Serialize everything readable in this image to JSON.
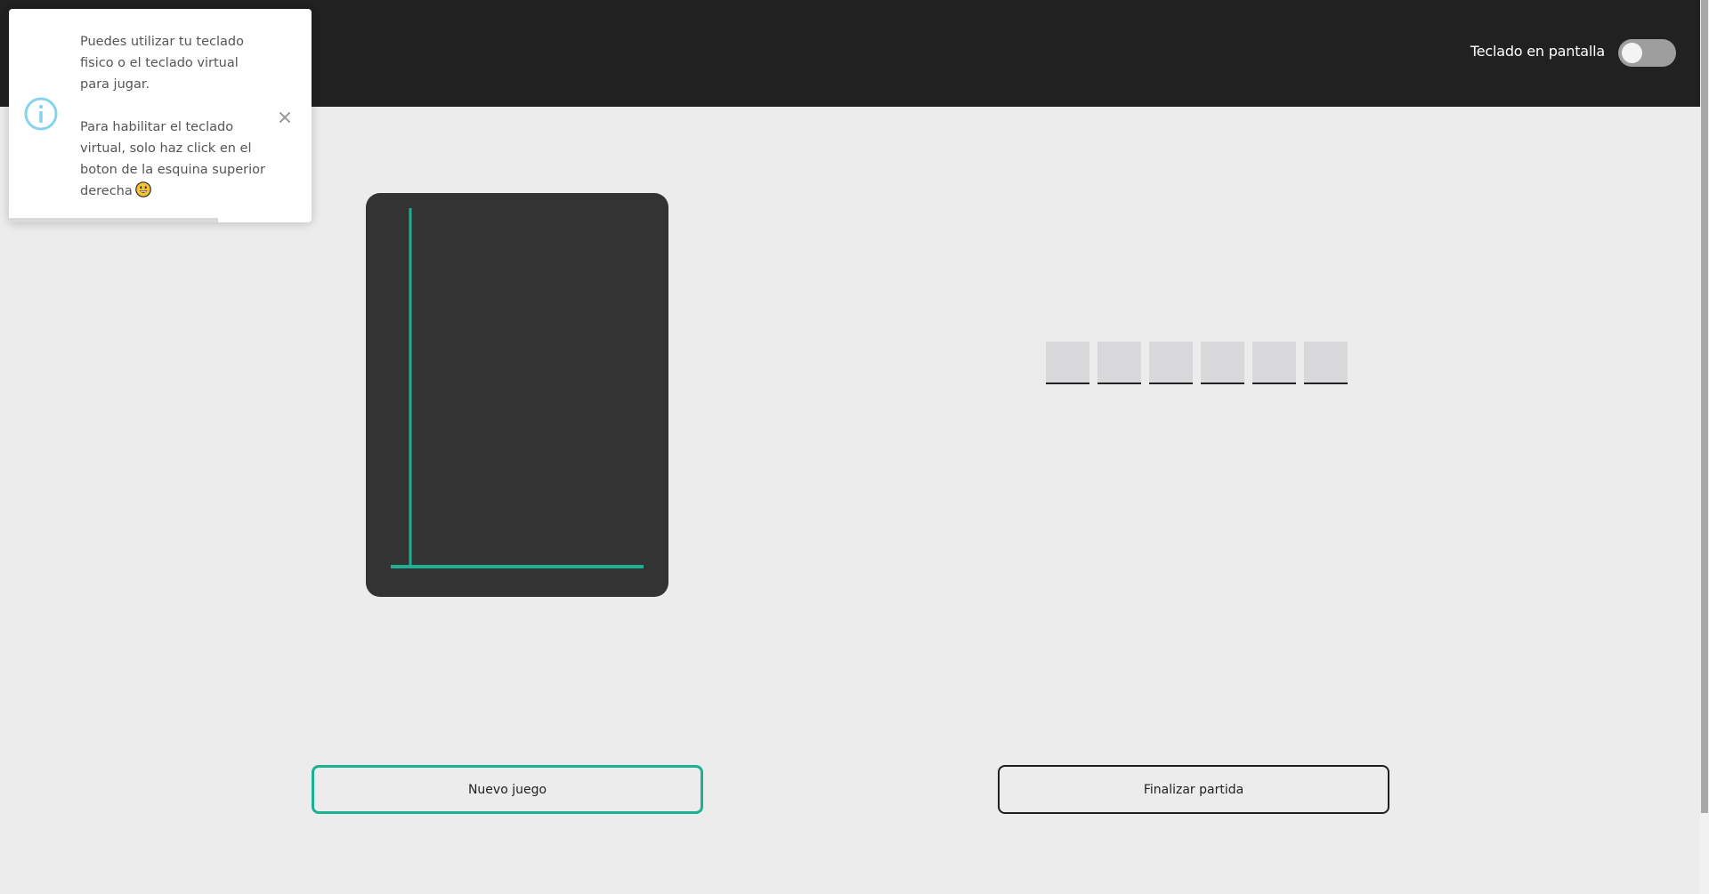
{
  "header": {
    "keyboard_label": "Teclado en pantalla",
    "keyboard_enabled": false
  },
  "toast": {
    "line1": "Puedes utilizar tu teclado fisico o el teclado virtual para jugar.",
    "line2": "Para habilitar el teclado virtual, solo haz click en el boton de la esquina superior derecha",
    "emoji": "😀",
    "icon": "info-icon",
    "close_icon": "close-icon",
    "progress_remaining": 0.69
  },
  "game": {
    "accent_color": "#1db193",
    "board_color": "#333333",
    "drawing": "gallows-base-and-post",
    "word_slots": [
      "",
      "",
      "",
      "",
      "",
      ""
    ]
  },
  "buttons": {
    "new_game": "Nuevo juego",
    "end_game": "Finalizar partida"
  }
}
